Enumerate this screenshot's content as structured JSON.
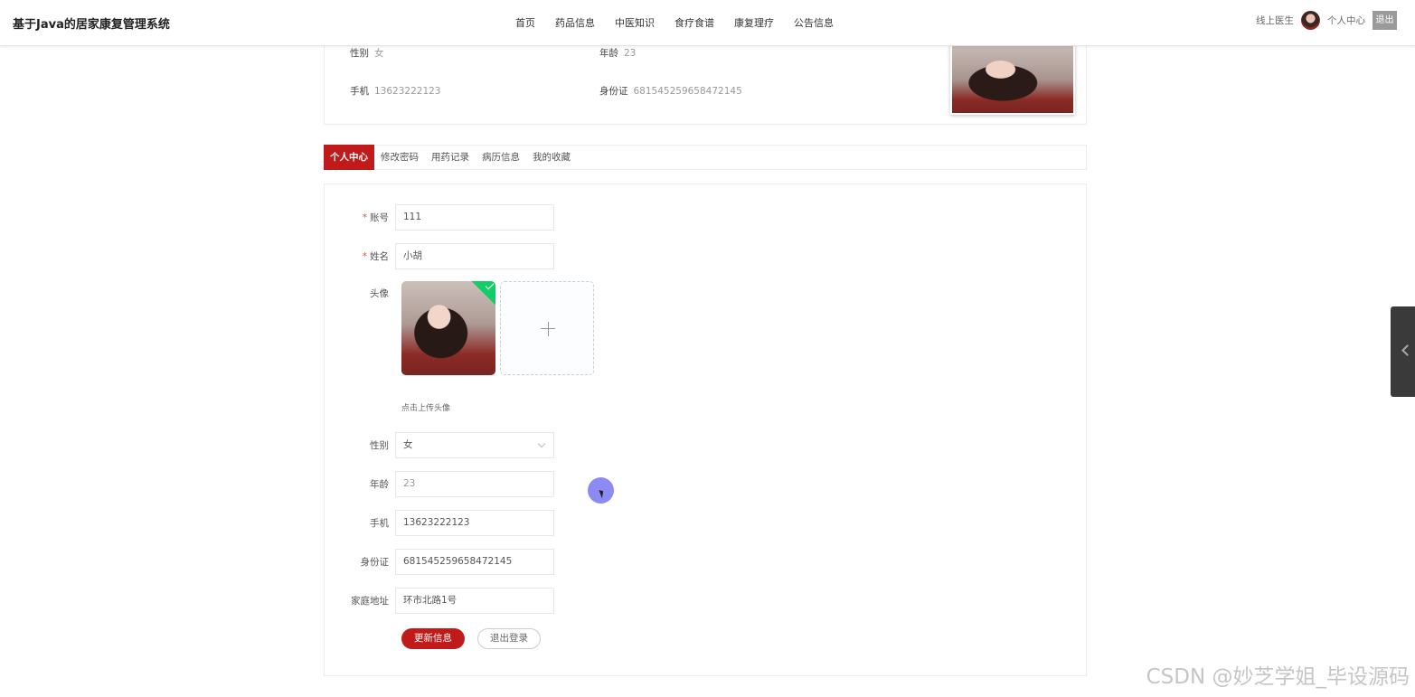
{
  "header": {
    "brand": "基于Java的居家康复管理系统",
    "nav": [
      "首页",
      "药品信息",
      "中医知识",
      "食疗食谱",
      "康复理疗",
      "公告信息"
    ],
    "online_doctor": "线上医生",
    "profile": "个人中心",
    "logout": "退出"
  },
  "info": {
    "gender_label": "性别",
    "gender_value": "女",
    "age_label": "年龄",
    "age_value": "23",
    "phone_label": "手机",
    "phone_value": "13623222123",
    "id_label": "身份证",
    "id_value": "681545259658472145"
  },
  "tabs": [
    "个人中心",
    "修改密码",
    "用药记录",
    "病历信息",
    "我的收藏"
  ],
  "form": {
    "account_label": "账号",
    "account_value": "111",
    "name_label": "姓名",
    "name_value": "小胡",
    "avatar_label": "头像",
    "upload_tip": "点击上传头像",
    "gender_label": "性别",
    "gender_value": "女",
    "age_label": "年龄",
    "age_value": "23",
    "phone_label": "手机",
    "phone_value": "13623222123",
    "id_label": "身份证",
    "id_value": "681545259658472145",
    "address_label": "家庭地址",
    "address_value": "环市北路1号",
    "update_button": "更新信息",
    "logout_button": "退出登录"
  },
  "watermark": "CSDN @妙芝学姐_毕设源码"
}
